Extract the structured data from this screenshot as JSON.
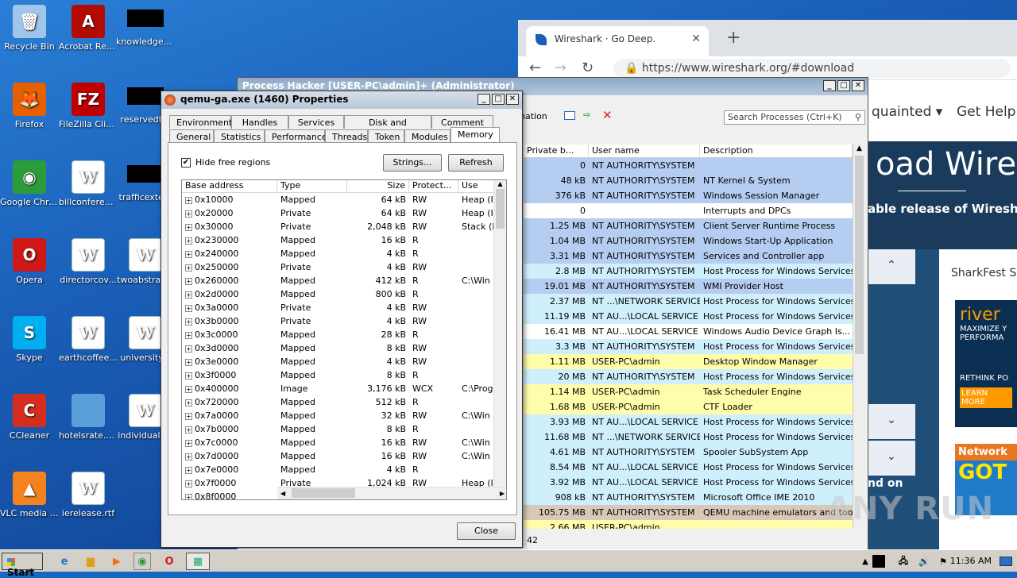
{
  "desktop": {
    "icons": [
      {
        "label": "Recycle Bin"
      },
      {
        "label": "Acrobat Reader DC"
      },
      {
        "label": "knowledgem..."
      },
      {
        "label": "Firefox"
      },
      {
        "label": "FileZilla Client"
      },
      {
        "label": "reservedt..."
      },
      {
        "label": "Google Chrome"
      },
      {
        "label": "billconferen..."
      },
      {
        "label": "trafficexte..."
      },
      {
        "label": "Opera"
      },
      {
        "label": "directorcov..."
      },
      {
        "label": "twoabstrac..."
      },
      {
        "label": "Skype"
      },
      {
        "label": "earthcoffee..."
      },
      {
        "label": "university..."
      },
      {
        "label": "CCleaner"
      },
      {
        "label": "hotelsrate.png"
      },
      {
        "label": "individuals..."
      },
      {
        "label": "VLC media player"
      },
      {
        "label": "ierelease.rtf"
      }
    ]
  },
  "browser": {
    "tab_title": "Wireshark · Go Deep.",
    "url": "https://www.wireshark.org/#download",
    "nav_item_1": "quainted",
    "nav_item_2": "Get Help",
    "hero_title": "oad Wires",
    "hero_sub": "able release of Wireshar",
    "sidebar_title": "SharkFest Sp",
    "ad_line1": "river",
    "ad_line2": "MAXIMIZE Y",
    "ad_line3": "PERFORMA",
    "ad_line4": "RETHINK PO",
    "ad_line5": "LEARN MORE",
    "ad2_line1": "Network",
    "ad2_line2": "GOT",
    "footer_text": "nd on"
  },
  "process_hacker": {
    "title": "Process Hacker [USER-PC\\admin]+ (Administrator)",
    "toolbar_partial": "nation",
    "search_placeholder": "Search Processes (Ctrl+K)",
    "columns": [
      "Private b...",
      "User name",
      "Description"
    ],
    "rows": [
      {
        "private": "0",
        "user": "NT AUTHORITY\\SYSTEM",
        "desc": "",
        "bg": "#b4cdf0"
      },
      {
        "private": "48 kB",
        "user": "NT AUTHORITY\\SYSTEM",
        "desc": "NT Kernel & System",
        "bg": "#b4cdf0"
      },
      {
        "private": "376 kB",
        "user": "NT AUTHORITY\\SYSTEM",
        "desc": "Windows Session Manager",
        "bg": "#b4cdf0"
      },
      {
        "private": "0",
        "user": "",
        "desc": "Interrupts and DPCs",
        "bg": "#ffffff"
      },
      {
        "private": "1.25 MB",
        "user": "NT AUTHORITY\\SYSTEM",
        "desc": "Client Server Runtime Process",
        "bg": "#b4cdf0"
      },
      {
        "private": "1.04 MB",
        "user": "NT AUTHORITY\\SYSTEM",
        "desc": "Windows Start-Up Application",
        "bg": "#b4cdf0"
      },
      {
        "private": "3.31 MB",
        "user": "NT AUTHORITY\\SYSTEM",
        "desc": "Services and Controller app",
        "bg": "#b4cdf0"
      },
      {
        "private": "2.8 MB",
        "user": "NT AUTHORITY\\SYSTEM",
        "desc": "Host Process for Windows Services",
        "bg": "#cfeffd"
      },
      {
        "private": "19.01 MB",
        "user": "NT AUTHORITY\\SYSTEM",
        "desc": "WMI Provider Host",
        "bg": "#b4cdf0"
      },
      {
        "private": "2.37 MB",
        "user": "NT ...\\NETWORK SERVICE",
        "desc": "Host Process for Windows Services",
        "bg": "#cfeffd"
      },
      {
        "private": "11.19 MB",
        "user": "NT AU...\\LOCAL SERVICE",
        "desc": "Host Process for Windows Services",
        "bg": "#cfeffd"
      },
      {
        "private": "16.41 MB",
        "user": "NT AU...\\LOCAL SERVICE",
        "desc": "Windows Audio Device Graph Is...",
        "bg": "#ffffff"
      },
      {
        "private": "3.3 MB",
        "user": "NT AUTHORITY\\SYSTEM",
        "desc": "Host Process for Windows Services",
        "bg": "#cfeffd"
      },
      {
        "private": "1.11 MB",
        "user": "USER-PC\\admin",
        "desc": "Desktop Window Manager",
        "bg": "#fffcaa"
      },
      {
        "private": "20 MB",
        "user": "NT AUTHORITY\\SYSTEM",
        "desc": "Host Process for Windows Services",
        "bg": "#cfeffd"
      },
      {
        "private": "1.14 MB",
        "user": "USER-PC\\admin",
        "desc": "Task Scheduler Engine",
        "bg": "#fffcaa"
      },
      {
        "private": "1.68 MB",
        "user": "USER-PC\\admin",
        "desc": "CTF Loader",
        "bg": "#fffcaa"
      },
      {
        "private": "3.93 MB",
        "user": "NT AU...\\LOCAL SERVICE",
        "desc": "Host Process for Windows Services",
        "bg": "#cfeffd"
      },
      {
        "private": "11.68 MB",
        "user": "NT ...\\NETWORK SERVICE",
        "desc": "Host Process for Windows Services",
        "bg": "#cfeffd"
      },
      {
        "private": "4.61 MB",
        "user": "NT AUTHORITY\\SYSTEM",
        "desc": "Spooler SubSystem App",
        "bg": "#cfeffd"
      },
      {
        "private": "8.54 MB",
        "user": "NT AU...\\LOCAL SERVICE",
        "desc": "Host Process for Windows Services",
        "bg": "#cfeffd"
      },
      {
        "private": "3.92 MB",
        "user": "NT AU...\\LOCAL SERVICE",
        "desc": "Host Process for Windows Services",
        "bg": "#cfeffd"
      },
      {
        "private": "908 kB",
        "user": "NT AUTHORITY\\SYSTEM",
        "desc": "Microsoft Office IME 2010",
        "bg": "#cfeffd"
      },
      {
        "private": "105.75 MB",
        "user": "NT AUTHORITY\\SYSTEM",
        "desc": "QEMU machine emulators and tools",
        "bg": "#d8c8b8"
      },
      {
        "private": "2.66 MB",
        "user": "USER-PC\\admin",
        "desc": "",
        "bg": "#fffcaa"
      }
    ],
    "status_count": "42"
  },
  "dialog": {
    "title": "qemu-ga.exe (1460) Properties",
    "tabs_row1": [
      "Environment",
      "Handles",
      "Services",
      "Disk and Network",
      "Comment"
    ],
    "tabs_row2": [
      "General",
      "Statistics",
      "Performance",
      "Threads",
      "Token",
      "Modules",
      "Memory"
    ],
    "hide_free_label": "Hide free regions",
    "hide_free_checked": "✔",
    "strings_button": "Strings...",
    "refresh_button": "Refresh",
    "close_button": "Close",
    "mem_columns": [
      "Base address",
      "Type",
      "Size",
      "Protect...",
      "Use"
    ],
    "mem_rows": [
      {
        "addr": "0x10000",
        "type": "Mapped",
        "size": "64 kB",
        "prot": "RW",
        "use": "Heap (I"
      },
      {
        "addr": "0x20000",
        "type": "Private",
        "size": "64 kB",
        "prot": "RW",
        "use": "Heap (I"
      },
      {
        "addr": "0x30000",
        "type": "Private",
        "size": "2,048 kB",
        "prot": "RW",
        "use": "Stack (I"
      },
      {
        "addr": "0x230000",
        "type": "Mapped",
        "size": "16 kB",
        "prot": "R",
        "use": ""
      },
      {
        "addr": "0x240000",
        "type": "Mapped",
        "size": "4 kB",
        "prot": "R",
        "use": ""
      },
      {
        "addr": "0x250000",
        "type": "Private",
        "size": "4 kB",
        "prot": "RW",
        "use": ""
      },
      {
        "addr": "0x260000",
        "type": "Mapped",
        "size": "412 kB",
        "prot": "R",
        "use": "C:\\Win"
      },
      {
        "addr": "0x2d0000",
        "type": "Mapped",
        "size": "800 kB",
        "prot": "R",
        "use": ""
      },
      {
        "addr": "0x3a0000",
        "type": "Private",
        "size": "4 kB",
        "prot": "RW",
        "use": ""
      },
      {
        "addr": "0x3b0000",
        "type": "Private",
        "size": "4 kB",
        "prot": "RW",
        "use": ""
      },
      {
        "addr": "0x3c0000",
        "type": "Mapped",
        "size": "28 kB",
        "prot": "R",
        "use": ""
      },
      {
        "addr": "0x3d0000",
        "type": "Mapped",
        "size": "8 kB",
        "prot": "RW",
        "use": ""
      },
      {
        "addr": "0x3e0000",
        "type": "Mapped",
        "size": "4 kB",
        "prot": "RW",
        "use": ""
      },
      {
        "addr": "0x3f0000",
        "type": "Mapped",
        "size": "8 kB",
        "prot": "R",
        "use": ""
      },
      {
        "addr": "0x400000",
        "type": "Image",
        "size": "3,176 kB",
        "prot": "WCX",
        "use": "C:\\Prog"
      },
      {
        "addr": "0x720000",
        "type": "Mapped",
        "size": "512 kB",
        "prot": "R",
        "use": ""
      },
      {
        "addr": "0x7a0000",
        "type": "Mapped",
        "size": "32 kB",
        "prot": "RW",
        "use": "C:\\Win"
      },
      {
        "addr": "0x7b0000",
        "type": "Mapped",
        "size": "8 kB",
        "prot": "R",
        "use": ""
      },
      {
        "addr": "0x7c0000",
        "type": "Mapped",
        "size": "16 kB",
        "prot": "RW",
        "use": "C:\\Win"
      },
      {
        "addr": "0x7d0000",
        "type": "Mapped",
        "size": "16 kB",
        "prot": "RW",
        "use": "C:\\Win"
      },
      {
        "addr": "0x7e0000",
        "type": "Mapped",
        "size": "4 kB",
        "prot": "R",
        "use": ""
      },
      {
        "addr": "0x7f0000",
        "type": "Private",
        "size": "1,024 kB",
        "prot": "RW",
        "use": "Heap (I"
      },
      {
        "addr": "0x8f0000",
        "type": "",
        "size": "",
        "prot": "",
        "use": ""
      }
    ]
  },
  "taskbar": {
    "start_label": "Start",
    "clock": "11:36 AM"
  },
  "watermark": "ANY RUN"
}
